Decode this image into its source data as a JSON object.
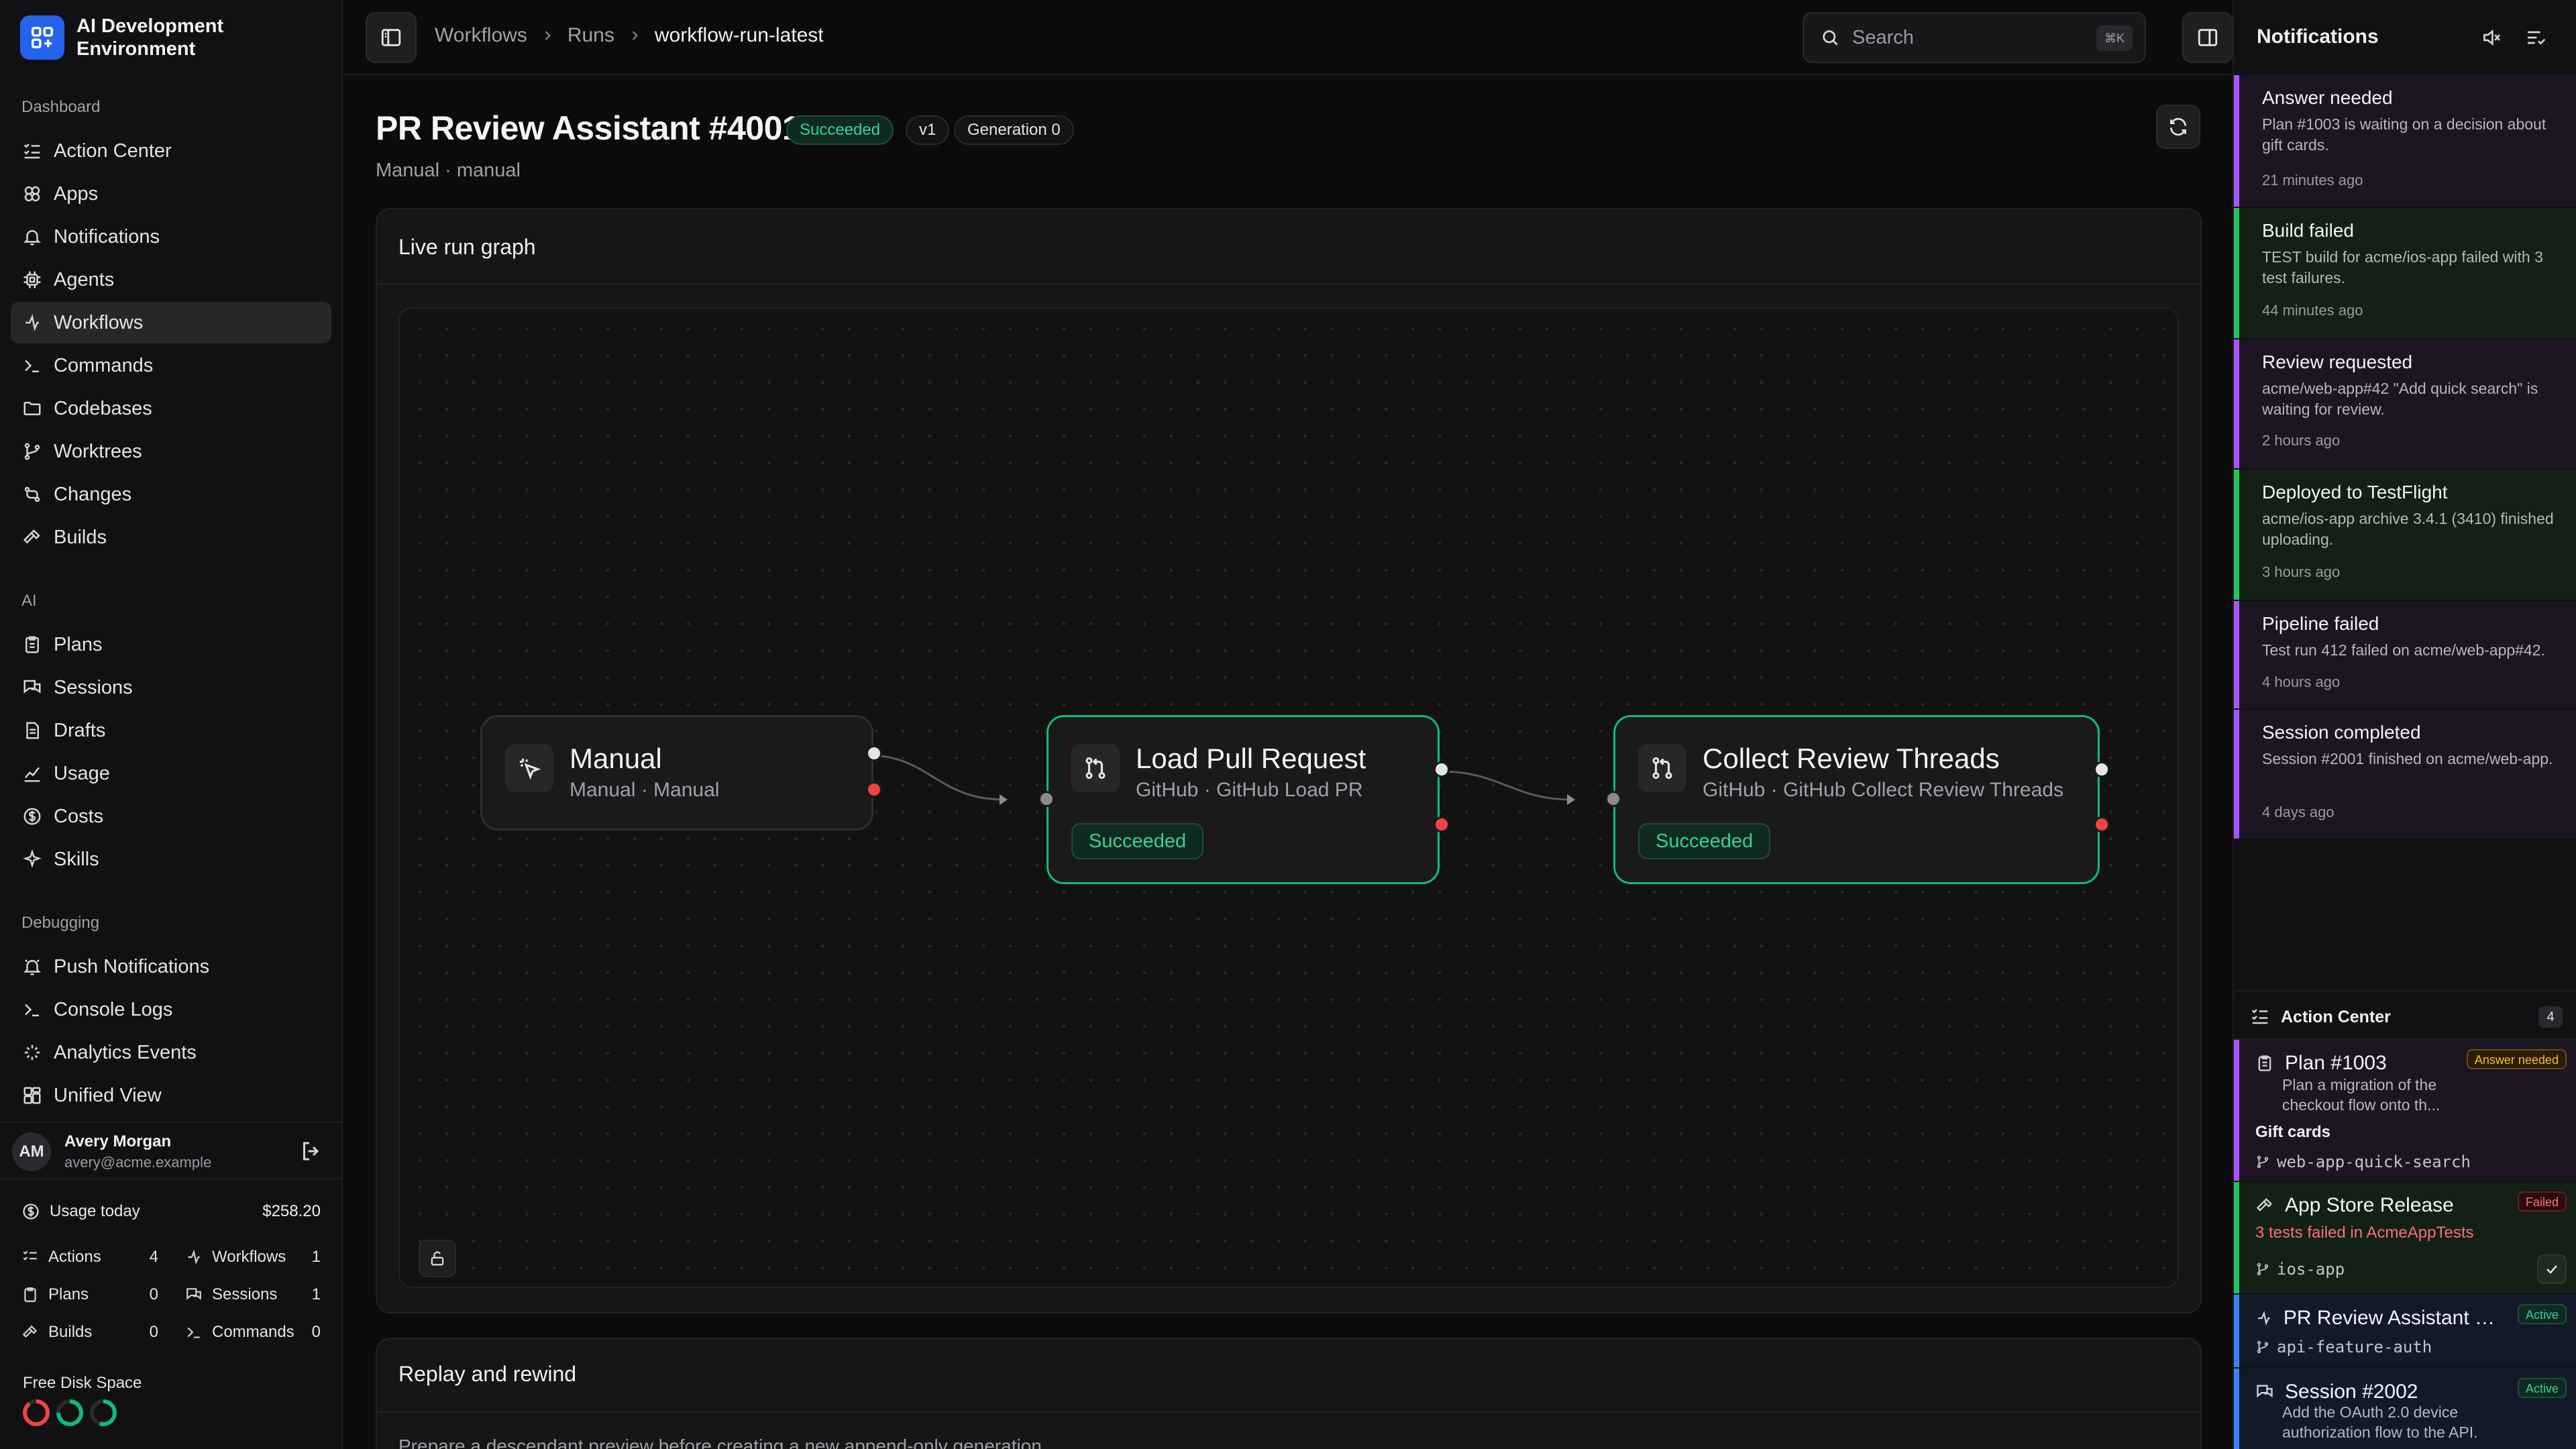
{
  "app": {
    "name": "AI Development Environment",
    "accent": "#2563eb"
  },
  "sidebar": {
    "sections": [
      {
        "label": "Dashboard",
        "items": [
          {
            "label": "Action Center",
            "icon": "list-check-icon"
          },
          {
            "label": "Apps",
            "icon": "apps-icon"
          },
          {
            "label": "Notifications",
            "icon": "bell-icon"
          },
          {
            "label": "Agents",
            "icon": "chip-icon"
          },
          {
            "label": "Workflows",
            "icon": "workflow-icon",
            "active": true
          },
          {
            "label": "Commands",
            "icon": "terminal-icon"
          },
          {
            "label": "Codebases",
            "icon": "folder-icon"
          },
          {
            "label": "Worktrees",
            "icon": "branch-icon"
          },
          {
            "label": "Changes",
            "icon": "diff-icon"
          },
          {
            "label": "Builds",
            "icon": "hammer-icon"
          }
        ]
      },
      {
        "label": "AI",
        "items": [
          {
            "label": "Plans",
            "icon": "clipboard-icon"
          },
          {
            "label": "Sessions",
            "icon": "chat-icon"
          },
          {
            "label": "Drafts",
            "icon": "document-icon"
          },
          {
            "label": "Usage",
            "icon": "chart-icon"
          },
          {
            "label": "Costs",
            "icon": "dollar-icon"
          },
          {
            "label": "Skills",
            "icon": "sparkle-icon"
          }
        ]
      },
      {
        "label": "Debugging",
        "items": [
          {
            "label": "Push Notifications",
            "icon": "bell-ring-icon"
          },
          {
            "label": "Console Logs",
            "icon": "terminal-icon"
          },
          {
            "label": "Analytics Events",
            "icon": "sparkle-icon"
          },
          {
            "label": "Unified View",
            "icon": "layout-icon"
          }
        ]
      }
    ],
    "user": {
      "initials": "AM",
      "name": "Avery Morgan",
      "email": "avery@acme.example"
    },
    "usage": {
      "label": "Usage today",
      "value": "$258.20",
      "stats": [
        {
          "label": "Actions",
          "value": "4"
        },
        {
          "label": "Workflows",
          "value": "1"
        },
        {
          "label": "Plans",
          "value": "0"
        },
        {
          "label": "Sessions",
          "value": "1"
        },
        {
          "label": "Builds",
          "value": "0"
        },
        {
          "label": "Commands",
          "value": "0"
        }
      ]
    },
    "disk": {
      "label": "Free Disk Space",
      "levels": [
        0.9,
        0.75,
        0.55
      ],
      "colors": [
        "#ef4444",
        "#10b981",
        "#10b981"
      ]
    }
  },
  "topbar": {
    "breadcrumbs": [
      "Workflows",
      "Runs",
      "workflow-run-latest"
    ],
    "search_placeholder": "Search",
    "search_shortcut": "⌘K"
  },
  "run": {
    "title": "PR Review Assistant #4001",
    "status": "Succeeded",
    "version": "v1",
    "generation": "Generation 0",
    "subtitle": "Manual · manual"
  },
  "graph": {
    "title": "Live run graph",
    "nodes": [
      {
        "title": "Manual",
        "subtitle": "Manual · Manual",
        "icon": "cursor-click-icon"
      },
      {
        "title": "Load Pull Request",
        "subtitle": "GitHub · GitHub Load PR",
        "status": "Succeeded",
        "icon": "pull-request-icon"
      },
      {
        "title": "Collect Review Threads",
        "subtitle": "GitHub · GitHub Collect Review Threads",
        "status": "Succeeded",
        "icon": "pull-request-icon"
      }
    ]
  },
  "replay": {
    "title": "Replay and rewind",
    "description": "Prepare a descendant preview before creating a new append-only generation."
  },
  "notifications": {
    "title": "Notifications",
    "items": [
      {
        "title": "Answer needed",
        "body": "Plan #1003 is waiting on a decision about gift cards.",
        "time": "21 minutes ago",
        "color": "#a855f7",
        "bg": "#1e1524"
      },
      {
        "title": "Build failed",
        "body": "TEST build for acme/ios-app failed with 3 test failures.",
        "time": "44 minutes ago",
        "color": "#22c55e",
        "bg": "#122016"
      },
      {
        "title": "Review requested",
        "body": "acme/web-app#42 \"Add quick search\" is waiting for review.",
        "time": "2 hours ago",
        "color": "#a855f7",
        "bg": "#1e1524"
      },
      {
        "title": "Deployed to TestFlight",
        "body": "acme/ios-app archive 3.4.1 (3410) finished uploading.",
        "time": "3 hours ago",
        "color": "#22c55e",
        "bg": "#122016"
      },
      {
        "title": "Pipeline failed",
        "body": "Test run 412 failed on acme/web-app#42.",
        "time": "4 hours ago",
        "color": "#a855f7",
        "bg": "#1e1524"
      },
      {
        "title": "Session completed",
        "body": "Session #2001 finished on acme/web-app.",
        "time": "4 days ago",
        "color": "#a855f7",
        "bg": "#1e1524"
      }
    ]
  },
  "action_center": {
    "title": "Action Center",
    "count": "4",
    "items": [
      {
        "title": "Plan #1003",
        "tag": "Answer needed",
        "tag_kind": "warn",
        "desc": "Plan a migration of the checkout flow onto th...",
        "extra": "Gift cards",
        "branch": "web-app-quick-search",
        "color": "#a855f7",
        "bg": "#1e1524",
        "icon": "clipboard-icon"
      },
      {
        "title": "App Store Release",
        "tag": "Failed",
        "tag_kind": "fail",
        "error": "3 tests failed in AcmeAppTests",
        "branch": "ios-app",
        "color": "#22c55e",
        "bg": "#122016",
        "icon": "hammer-icon"
      },
      {
        "title": "PR Review Assistant #4...",
        "tag": "Active",
        "tag_kind": "act",
        "branch": "api-feature-auth",
        "color": "#3b82f6",
        "bg": "#121a2a",
        "icon": "workflow-icon"
      },
      {
        "title": "Session #2002",
        "tag": "Active",
        "tag_kind": "act",
        "desc": "Add the OAuth 2.0 device authorization flow to the API.",
        "color": "#3b82f6",
        "bg": "#121a2a",
        "icon": "chat-icon"
      }
    ]
  }
}
